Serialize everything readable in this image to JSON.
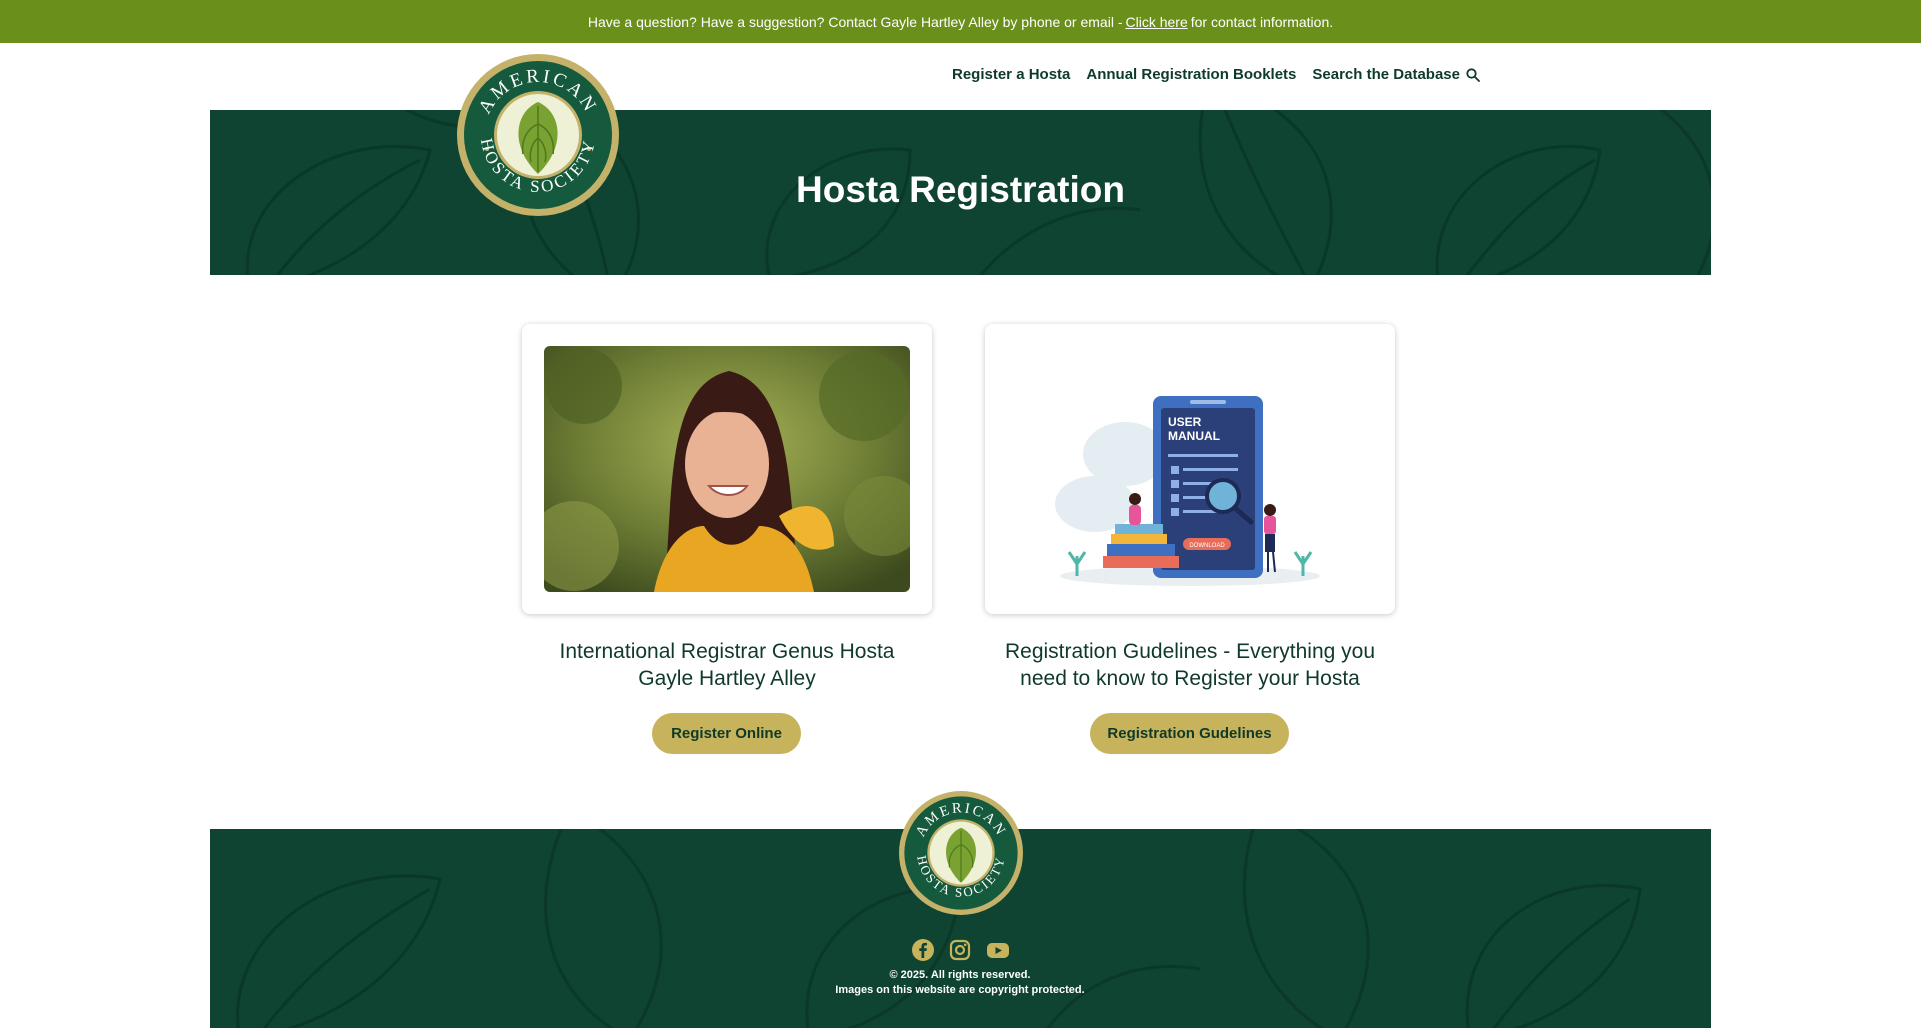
{
  "topbar": {
    "text_before": "Have a question? Have a suggestion? Contact Gayle Hartley Alley by phone or email -",
    "link": "Click here",
    "text_after": "for contact information."
  },
  "nav": {
    "items": [
      "Register a Hosta",
      "Annual Registration Booklets",
      "Search the Database"
    ]
  },
  "logo": {
    "top_text": "AMERICAN",
    "bottom_text": "HOSTA SOCIETY"
  },
  "hero": {
    "title": "Hosta Registration"
  },
  "cards": [
    {
      "caption_line1": "International Registrar Genus Hosta",
      "caption_line2": "Gayle Hartley Alley",
      "button": "Register Online"
    },
    {
      "caption_line1": "Registration Gudelines - Everything you",
      "caption_line2": "need to know to Register your Hosta",
      "button": "Registration Gudelines",
      "illustration": {
        "title_line1": "USER",
        "title_line2": "MANUAL",
        "download": "DOWNLOAD"
      }
    }
  ],
  "footer": {
    "social_icons": [
      "facebook-icon",
      "instagram-icon",
      "youtube-icon"
    ],
    "copyright": "© 2025. All rights reserved.",
    "notice": "Images on this website are copyright protected."
  },
  "colors": {
    "topbar": "#6a8f1a",
    "dark_green": "#0e4431",
    "gold": "#c7b35c",
    "text_dark": "#0f3a2a"
  }
}
